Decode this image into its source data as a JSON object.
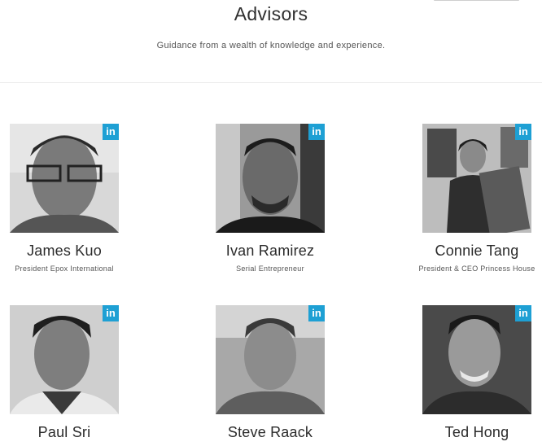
{
  "header": {
    "title": "Advisors",
    "subtitle": "Guidance from a wealth of knowledge and experience."
  },
  "linkedin_label": "in",
  "advisors": [
    {
      "name": "James Kuo",
      "role": "President Epox International"
    },
    {
      "name": "Ivan Ramirez",
      "role": "Serial Entrepreneur"
    },
    {
      "name": "Connie Tang",
      "role": "President & CEO Princess House"
    },
    {
      "name": "Paul Sri",
      "role": ""
    },
    {
      "name": "Steve Raack",
      "role": ""
    },
    {
      "name": "Ted Hong",
      "role": ""
    }
  ],
  "colors": {
    "linkedin": "#1ea0d4",
    "divider": "#ececec"
  }
}
